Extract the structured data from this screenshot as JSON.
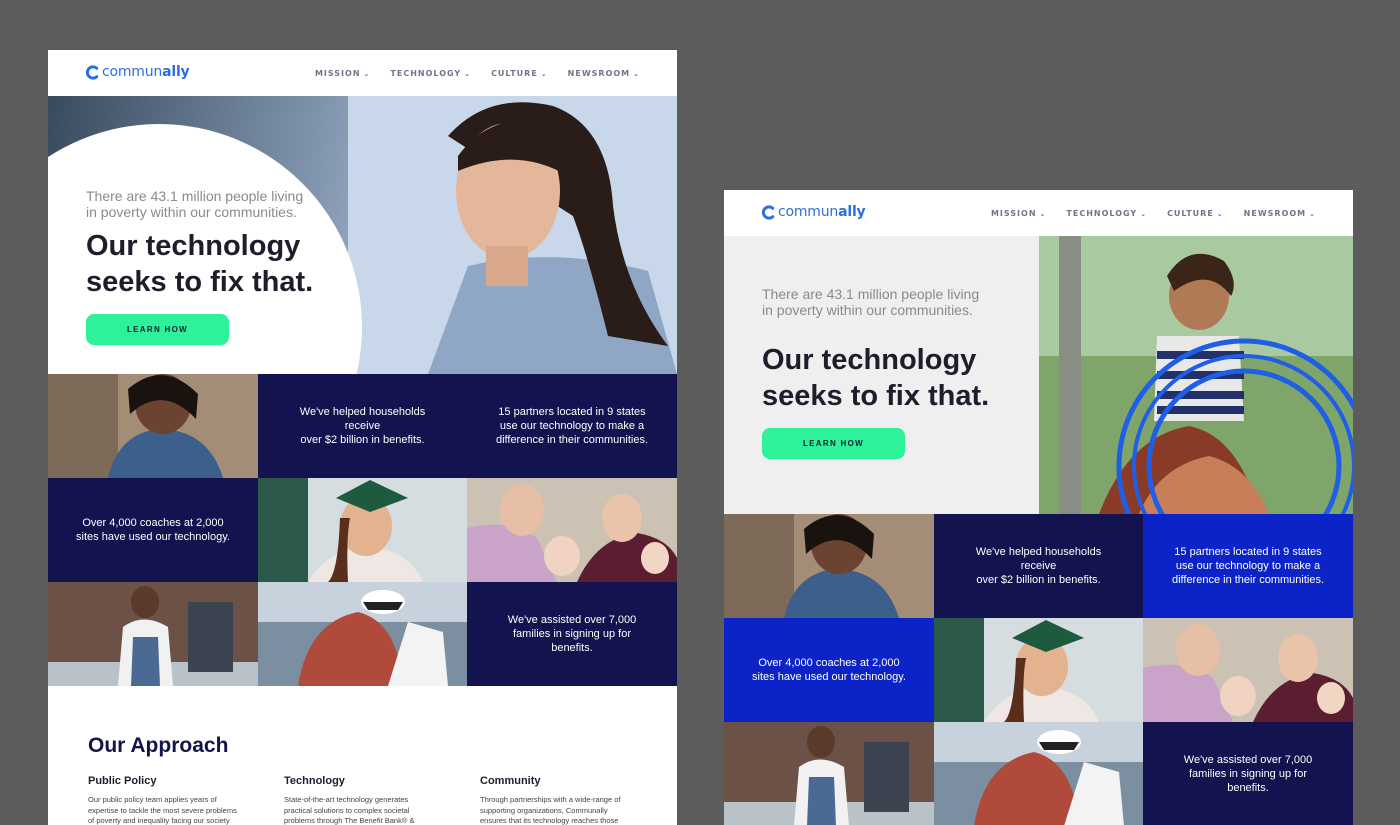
{
  "brand": {
    "logo_prefix": "commun",
    "logo_suffix": "ally",
    "colors": {
      "accent": "#2b6fe0",
      "navy": "#13134f",
      "royal": "#0c24c7",
      "cta": "#2df29a"
    }
  },
  "nav": [
    {
      "label": "MISSION"
    },
    {
      "label": "TECHNOLOGY"
    },
    {
      "label": "CULTURE"
    },
    {
      "label": "NEWSROOM"
    }
  ],
  "hero": {
    "intro_line1": "There are 43.1 million people living",
    "intro_line2": "in poverty within our communities.",
    "headline_line1": "Our technology",
    "headline_line2": "seeks to fix that.",
    "cta": "LEARN HOW"
  },
  "stats": {
    "benefits_line1": "We've helped households receive",
    "benefits_line2": "over $2 billion in benefits.",
    "partners_line1": "15 partners located in 9 states",
    "partners_line2": "use our technology to make a",
    "partners_line3": "difference in their communities.",
    "coaches_line1": "Over 4,000 coaches at 2,000",
    "coaches_line2": "sites have used our technology.",
    "families_line1": "We've assisted over 7,000",
    "families_line2": "families in signing up for",
    "families_line3": "benefits."
  },
  "approach": {
    "title": "Our Approach",
    "columns": [
      {
        "title": "Public Policy",
        "line1": "Our public policy team applies years of",
        "line2": "expertise to tackle the most severe problems",
        "line3": "of poverty and inequality facing our society"
      },
      {
        "title": "Technology",
        "line1": "State-of-the-art technology generates",
        "line2": "practical solutions to complex societal",
        "line3": "problems through The Benefit Bank® &"
      },
      {
        "title": "Community",
        "line1": "Through partnerships with a wide-range of",
        "line2": "supporting organizations, Communally",
        "line3": "ensures that its technology reaches those"
      }
    ]
  }
}
